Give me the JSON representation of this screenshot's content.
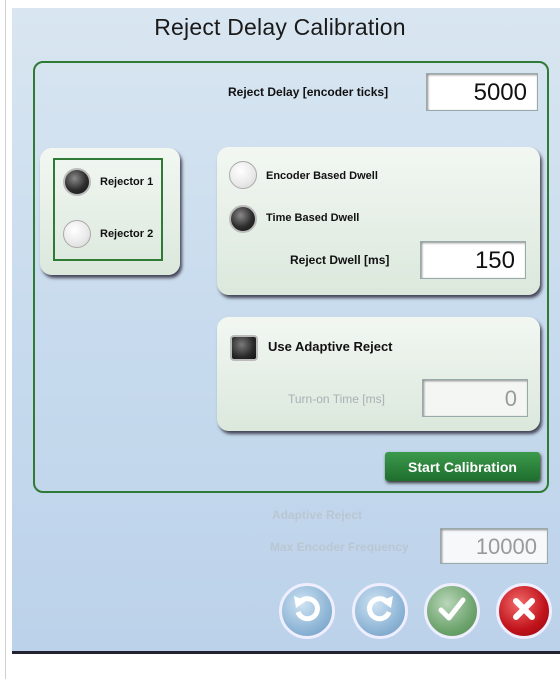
{
  "title": "Reject Delay Calibration",
  "reject_delay": {
    "label": "Reject Delay [encoder ticks]",
    "value": "5000"
  },
  "rejectors": [
    {
      "label": "Rejector 1",
      "selected": true
    },
    {
      "label": "Rejector 2",
      "selected": false
    }
  ],
  "dwell": {
    "encoder_label": "Encoder Based Dwell",
    "encoder_selected": false,
    "time_label": "Time Based Dwell",
    "time_selected": true,
    "dwell_label": "Reject Dwell [ms]",
    "dwell_value": "150"
  },
  "adaptive": {
    "checkbox_label": "Use Adaptive Reject",
    "checked": false,
    "turn_on_label": "Turn-on Time [ms]",
    "turn_on_value": "0"
  },
  "start_button": "Start Calibration",
  "adaptive_footer": {
    "heading": "Adaptive Reject",
    "freq_label": "Max Encoder Frequency",
    "freq_value": "10000"
  },
  "icons": {
    "undo": "undo-icon",
    "redo": "redo-icon",
    "confirm": "checkmark-icon",
    "cancel": "close-icon"
  },
  "colors": {
    "frame_green": "#2f7a34",
    "button_green": "#2b8a3c",
    "cancel_red": "#c0121a"
  }
}
